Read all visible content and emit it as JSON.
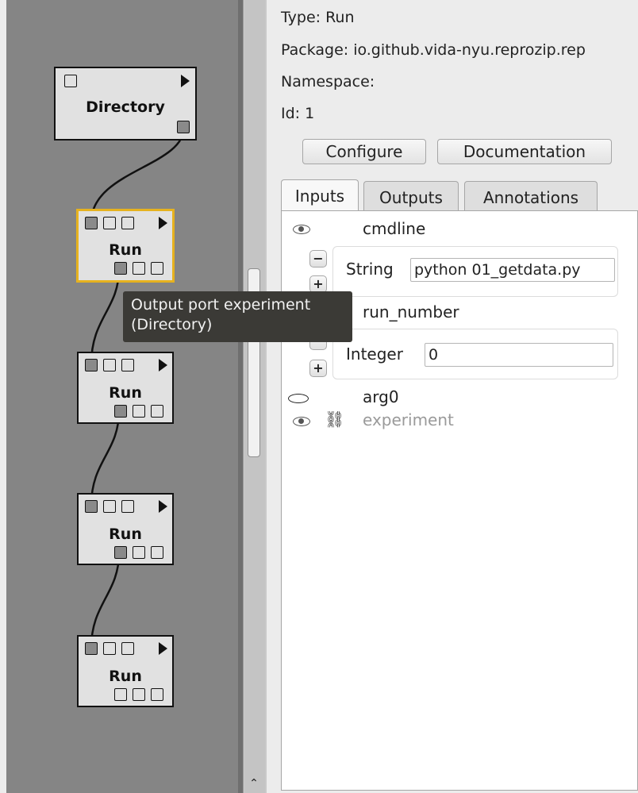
{
  "pipeline": {
    "modules": [
      {
        "label": "Directory",
        "kind": "directory"
      },
      {
        "label": "Run",
        "kind": "run",
        "selected": true
      },
      {
        "label": "Run",
        "kind": "run"
      },
      {
        "label": "Run",
        "kind": "run"
      },
      {
        "label": "Run",
        "kind": "run"
      }
    ],
    "tooltip": {
      "line1": "Output port experiment",
      "line2": "(Directory)"
    }
  },
  "module_info": {
    "type_line": "Type: Run",
    "package_line": "Package: io.github.vida-nyu.reprozip.rep",
    "namespace_line": "Namespace:",
    "id_line": "Id: 1"
  },
  "buttons": {
    "configure": "Configure",
    "documentation": "Documentation"
  },
  "tabs": [
    {
      "label": "Inputs",
      "active": true
    },
    {
      "label": "Outputs"
    },
    {
      "label": "Annotations"
    }
  ],
  "inputs": {
    "cmdline": {
      "name": "cmdline",
      "type_label": "String",
      "value": "python 01_getdata.py"
    },
    "run_number": {
      "name": "run_number",
      "type_label": "Integer",
      "value": "0"
    },
    "arg0": {
      "name": "arg0"
    },
    "experiment": {
      "name": "experiment"
    }
  },
  "icons": {
    "eye": "eye-icon",
    "link": "link-icon",
    "play": "play-icon",
    "minus": "minus-icon",
    "plus": "plus-icon",
    "scroll_up": "chevron-up-icon"
  },
  "colors": {
    "canvas": "#858585",
    "selected_border": "#e6b21f",
    "tooltip_bg": "#3b3a36"
  }
}
